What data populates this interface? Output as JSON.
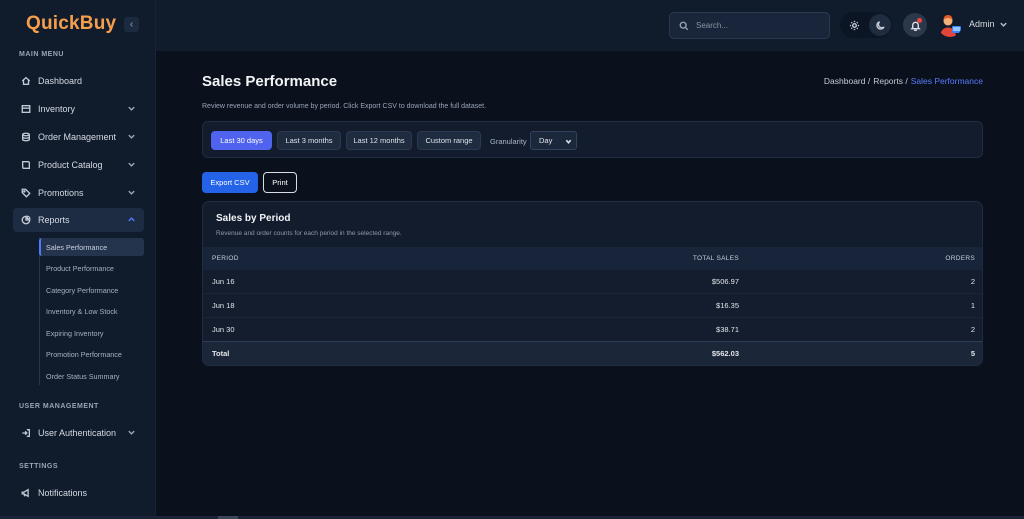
{
  "app": {
    "logo": "QuickBuy",
    "collapse_icon": "‹"
  },
  "sidebar": {
    "main_menu_label": "MAIN MENU",
    "items": [
      {
        "label": "Dashboard",
        "icon": "home-icon"
      },
      {
        "label": "Inventory",
        "icon": "box-icon"
      },
      {
        "label": "Order Management",
        "icon": "database-icon"
      },
      {
        "label": "Product Catalog",
        "icon": "book-icon"
      },
      {
        "label": "Promotions",
        "icon": "tag-icon"
      },
      {
        "label": "Reports",
        "icon": "pie-chart-icon"
      }
    ],
    "reports_sub": [
      "Sales Performance",
      "Product Performance",
      "Category Performance",
      "Inventory & Low Stock",
      "Expiring Inventory",
      "Promotion Performance",
      "Order Status Summary"
    ],
    "user_mgmt_label": "USER MANAGEMENT",
    "user_auth_label": "User Authentication",
    "settings_label": "SETTINGS",
    "notifications_label": "Notifications"
  },
  "topbar": {
    "search_placeholder": "Search...",
    "user_name": "Admin"
  },
  "page": {
    "title": "Sales Performance",
    "breadcrumb": [
      "Dashboard /",
      "Reports /",
      "Sales Performance"
    ],
    "description": "Review revenue and order volume by period. Click Export CSV to download the full dataset."
  },
  "filters": {
    "ranges": [
      "Last 30 days",
      "Last 3 months",
      "Last 12 months",
      "Custom range"
    ],
    "active_range": "Last 30 days",
    "granularity_label": "Granularity",
    "granularity_value": "Day"
  },
  "actions": {
    "export": "Export CSV",
    "print": "Print"
  },
  "table": {
    "title": "Sales by Period",
    "subtitle": "Revenue and order counts for each period in the selected range.",
    "headers": {
      "period": "PERIOD",
      "sales": "TOTAL SALES",
      "orders": "ORDERS"
    },
    "rows": [
      {
        "period": "Jun 16",
        "sales": "$506.97",
        "orders": "2"
      },
      {
        "period": "Jun 18",
        "sales": "$16.35",
        "orders": "1"
      },
      {
        "period": "Jun 30",
        "sales": "$38.71",
        "orders": "2"
      }
    ],
    "total": {
      "period": "Total",
      "sales": "$562.03",
      "orders": "5"
    }
  },
  "colors": {
    "accent": "#4f63ef",
    "export_button": "#2463e8",
    "logo": "#f59e4c",
    "breadcrumb_current": "#5a7bff",
    "background": "#0a111d",
    "sidebar": "#101b2c"
  }
}
